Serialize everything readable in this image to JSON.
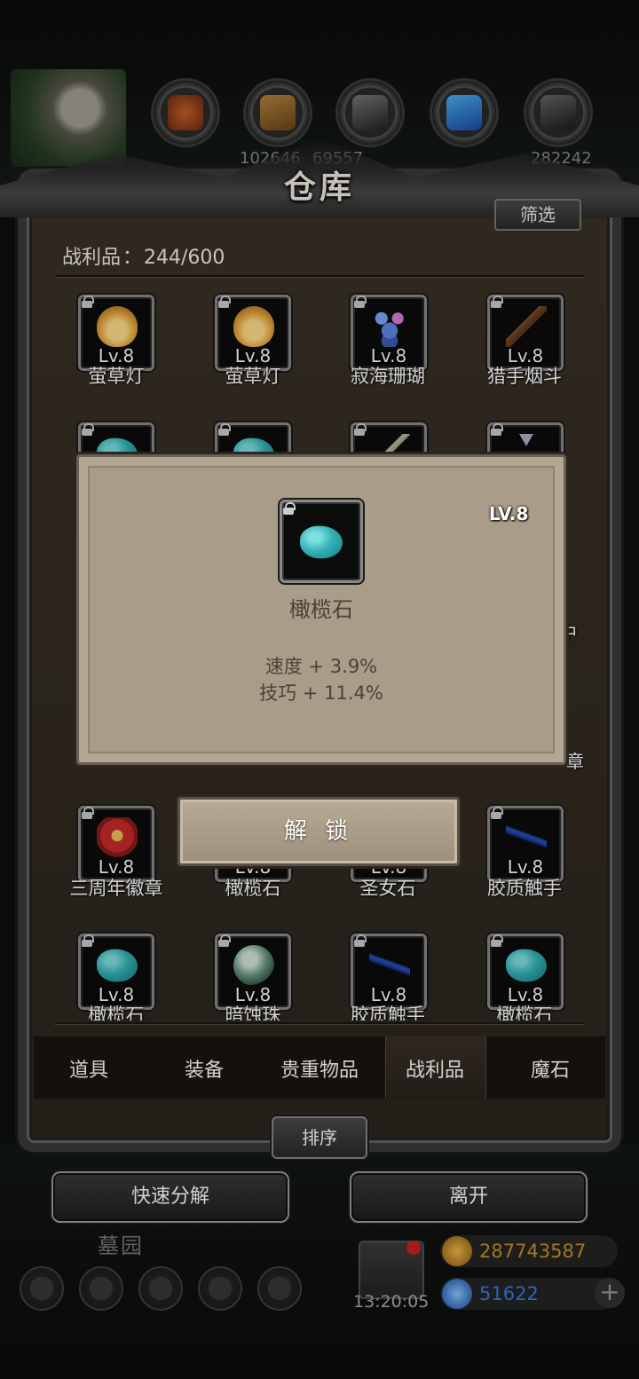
{
  "top_resources": {
    "numbers": [
      "102646",
      "69557",
      "282242"
    ]
  },
  "warehouse": {
    "title": "仓库",
    "filter_label": "筛选",
    "count_label": "战利品",
    "count_sep": "：",
    "count_value": "244/600"
  },
  "items": [
    {
      "name": "萤草灯",
      "level": "Lv.8",
      "icon": "lantern-icon"
    },
    {
      "name": "萤草灯",
      "level": "Lv.8",
      "icon": "lantern-icon"
    },
    {
      "name": "寂海珊瑚",
      "level": "Lv.8",
      "icon": "coral-icon"
    },
    {
      "name": "猎手烟斗",
      "level": "Lv.8",
      "icon": "pipe-icon"
    },
    {
      "name": "三周年徽章",
      "level": "Lv.8",
      "icon": "badge-icon"
    },
    {
      "name": "橄榄石",
      "level": "Lv.8",
      "icon": "olivine-icon"
    },
    {
      "name": "圣女石",
      "level": "Lv.8",
      "icon": "saint-stone-icon"
    },
    {
      "name": "胶质触手",
      "level": "Lv.8",
      "icon": "tentacle-icon"
    },
    {
      "name": "橄榄石",
      "level": "Lv.8",
      "icon": "olivine-icon"
    },
    {
      "name": "暗蚀珠",
      "level": "Lv.8",
      "icon": "dark-pearl-icon"
    },
    {
      "name": "胶质触手",
      "level": "Lv.8",
      "icon": "tentacle-icon"
    },
    {
      "name": "橄榄石",
      "level": "Lv.8",
      "icon": "olivine-icon"
    }
  ],
  "hidden_fragments": {
    "right_char_1": "中",
    "right_char_2": "章"
  },
  "popup": {
    "level": "LV.8",
    "name": "橄榄石",
    "stats": [
      "速度 + 3.9%",
      "技巧 + 11.4%"
    ],
    "unlock_label": "解 锁",
    "icon": "olivine-icon"
  },
  "tabs": [
    {
      "label": "道具",
      "active": false
    },
    {
      "label": "装备",
      "active": false
    },
    {
      "label": "贵重物品",
      "active": false
    },
    {
      "label": "战利品",
      "active": true
    },
    {
      "label": "魔石",
      "active": false
    }
  ],
  "sort_label": "排序",
  "actions": {
    "quick_decompose": "快速分解",
    "leave": "离开"
  },
  "bottom_hud": {
    "area_name": "墓园",
    "timer": "13:20:05",
    "gold": "287743587",
    "gems": "51622",
    "colors": {
      "gold": "#c8902a",
      "gem": "#3a7ad8"
    }
  }
}
